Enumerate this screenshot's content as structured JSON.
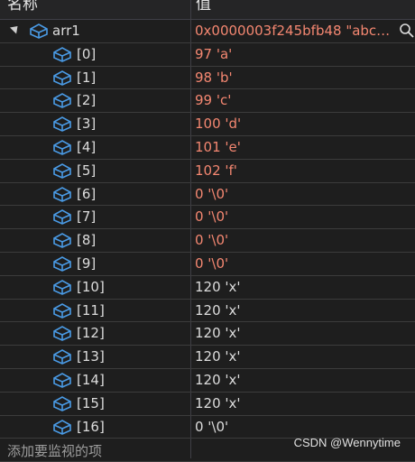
{
  "header": {
    "name_label": "名称",
    "value_label": "值"
  },
  "root": {
    "name": "arr1",
    "value": "0x0000003f245bfb48 \"abc…"
  },
  "items": [
    {
      "name": "[0]",
      "value": "97 'a'",
      "changed": true
    },
    {
      "name": "[1]",
      "value": "98 'b'",
      "changed": true
    },
    {
      "name": "[2]",
      "value": "99 'c'",
      "changed": true
    },
    {
      "name": "[3]",
      "value": "100 'd'",
      "changed": true
    },
    {
      "name": "[4]",
      "value": "101 'e'",
      "changed": true
    },
    {
      "name": "[5]",
      "value": "102 'f'",
      "changed": true
    },
    {
      "name": "[6]",
      "value": "0 '\\0'",
      "changed": true
    },
    {
      "name": "[7]",
      "value": "0 '\\0'",
      "changed": true
    },
    {
      "name": "[8]",
      "value": "0 '\\0'",
      "changed": true
    },
    {
      "name": "[9]",
      "value": "0 '\\0'",
      "changed": true
    },
    {
      "name": "[10]",
      "value": "120 'x'",
      "changed": false
    },
    {
      "name": "[11]",
      "value": "120 'x'",
      "changed": false
    },
    {
      "name": "[12]",
      "value": "120 'x'",
      "changed": false
    },
    {
      "name": "[13]",
      "value": "120 'x'",
      "changed": false
    },
    {
      "name": "[14]",
      "value": "120 'x'",
      "changed": false
    },
    {
      "name": "[15]",
      "value": "120 'x'",
      "changed": false
    },
    {
      "name": "[16]",
      "value": "0 '\\0'",
      "changed": false
    }
  ],
  "add_watch_placeholder": "添加要监视的项",
  "watermark": "CSDN @Wennytime",
  "colors": {
    "changed_value": "#f48771",
    "normal_value": "#dcdcdc",
    "icon": "#4a9be6"
  },
  "icons": {
    "variable": "cube-icon",
    "search": "magnifier-icon",
    "expander": "expanded-triangle-icon"
  }
}
